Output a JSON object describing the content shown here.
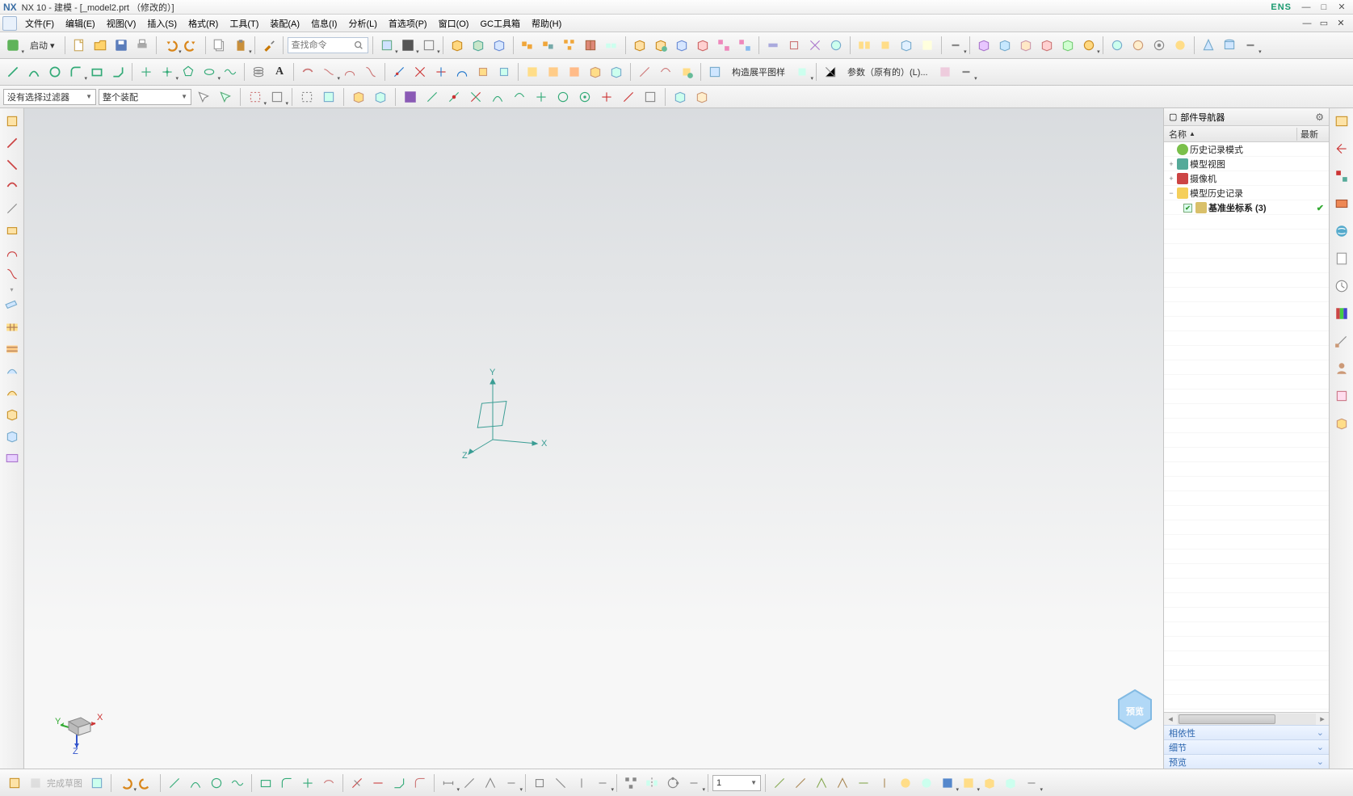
{
  "title": "NX 10 - 建模 - [_model2.prt （修改的）]",
  "brand": "ENS",
  "menus": [
    "文件(F)",
    "编辑(E)",
    "视图(V)",
    "插入(S)",
    "格式(R)",
    "工具(T)",
    "装配(A)",
    "信息(I)",
    "分析(L)",
    "首选项(P)",
    "窗口(O)",
    "GC工具箱",
    "帮助(H)"
  ],
  "start_button": "启动",
  "search_placeholder": "查找命令",
  "text_button1": "构造展平图样",
  "text_button2": "参数（原有的）(L)...",
  "filter1": "没有选择过滤器",
  "filter2": "整个装配",
  "nav_title": "部件导航器",
  "nav_col1": "名称",
  "nav_col2": "最新",
  "tree": {
    "r1": "历史记录模式",
    "r2": "模型视图",
    "r3": "摄像机",
    "r4": "模型历史记录",
    "r5": "基准坐标系 (3)"
  },
  "section1": "相依性",
  "section2": "细节",
  "section3": "预览",
  "status_combo": "1",
  "axes": {
    "x": "X",
    "y": "Y",
    "z": "Z"
  }
}
